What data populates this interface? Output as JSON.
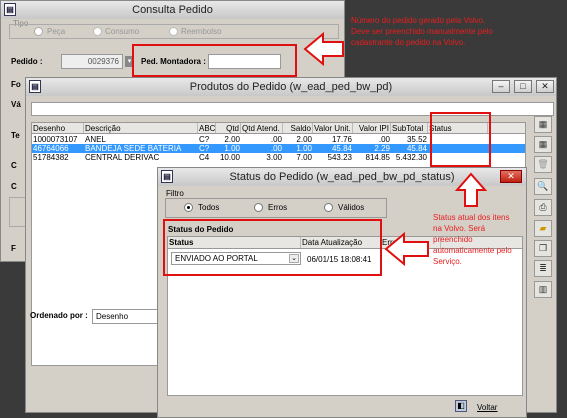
{
  "consulta": {
    "title": "Consulta Pedido",
    "tipo_label": "Tipo",
    "tipo_options": [
      "Peça",
      "Consumo",
      "Reembolso"
    ],
    "pedido_label": "Pedido :",
    "pedido_value": "0029376",
    "montadora_label": "Ped. Montadora :",
    "montadora_value": "",
    "side_labels": [
      "Fo",
      "Vá",
      "Te",
      "C",
      "C",
      "F"
    ],
    "ordenado_label": "Ordenado por :",
    "ordenado_value": "Desenho"
  },
  "produtos": {
    "title": "Produtos do Pedido (w_ead_ped_bw_pd)",
    "columns": [
      "Desenho",
      "Descrição",
      "ABC",
      "Qtd",
      "Qtd Atend.",
      "Saldo",
      "Valor Unit.",
      "Valor IPI",
      "SubTotal",
      "Status"
    ],
    "rows": [
      [
        "1000073107",
        "ANEL",
        "C?",
        "2.00",
        ".00",
        "2.00",
        "17.76",
        ".00",
        "35.52",
        ""
      ],
      [
        "46764066",
        "BANDEJA SEDE BATERIA",
        "C?",
        "1.00",
        ".00",
        "1.00",
        "45.84",
        "2.29",
        "45.84",
        ""
      ],
      [
        "51784382",
        "CENTRAL DERIVAC",
        "C4",
        "10.00",
        "3.00",
        "7.00",
        "543.23",
        "814.85",
        "5.432.30",
        ""
      ]
    ],
    "toolbar_icons": [
      "grid-icon",
      "grid-icon",
      "trash-icon",
      "preview-icon",
      "print-icon",
      "folder-icon",
      "copy-icon",
      "list-icon",
      "chart-icon"
    ]
  },
  "status": {
    "title": "Status do Pedido (w_ead_ped_bw_pd_status)",
    "filtro_label": "Filtro",
    "filtro_options": [
      "Todos",
      "Erros",
      "Válidos"
    ],
    "group_label": "Status do Pedido",
    "col_status": "Status",
    "col_data": "Data Atualização",
    "col_erro": "Erro",
    "status_value": "ENVIADO AO PORTAL",
    "data_value": "06/01/15 18:08:41",
    "voltar_label": "Voltar"
  },
  "annotations": {
    "note1": "Número do pedido gerado pela Volvo. Deve ser preenchido manualmente pelo cadastrante do pedido na Volvo.",
    "note2": "Status atual dos itens na Volvo. Será preenchido automaticamente pelo Serviço."
  },
  "colors": {
    "annotation": "#e01010",
    "selection": "#3399ff",
    "arrow_fill": "#ffffff"
  }
}
